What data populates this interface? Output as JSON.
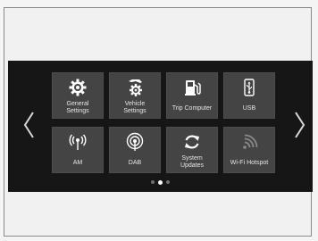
{
  "tiles": [
    {
      "label_line1": "General",
      "label_line2": "Settings",
      "icon": "gear-icon"
    },
    {
      "label_line1": "Vehicle",
      "label_line2": "Settings",
      "icon": "vehicle-gear-icon"
    },
    {
      "label_line1": "Trip Computer",
      "label_line2": "",
      "icon": "fuel-pump-icon"
    },
    {
      "label_line1": "USB",
      "label_line2": "",
      "icon": "usb-icon"
    },
    {
      "label_line1": "AM",
      "label_line2": "",
      "icon": "radio-antenna-icon"
    },
    {
      "label_line1": "DAB",
      "label_line2": "",
      "icon": "dab-antenna-icon"
    },
    {
      "label_line1": "System",
      "label_line2": "Updates",
      "icon": "refresh-icon"
    },
    {
      "label_line1": "Wi-Fi Hotspot",
      "label_line2": "",
      "icon": "wifi-icon"
    }
  ],
  "nav": {
    "prev_icon": "chevron-left-icon",
    "next_icon": "chevron-right-icon"
  },
  "pager": {
    "pages": 3,
    "current": 2
  },
  "colors": {
    "screen": "#161616",
    "tile": "#444444",
    "icon": "#ffffff",
    "text": "#e6e6e6"
  }
}
